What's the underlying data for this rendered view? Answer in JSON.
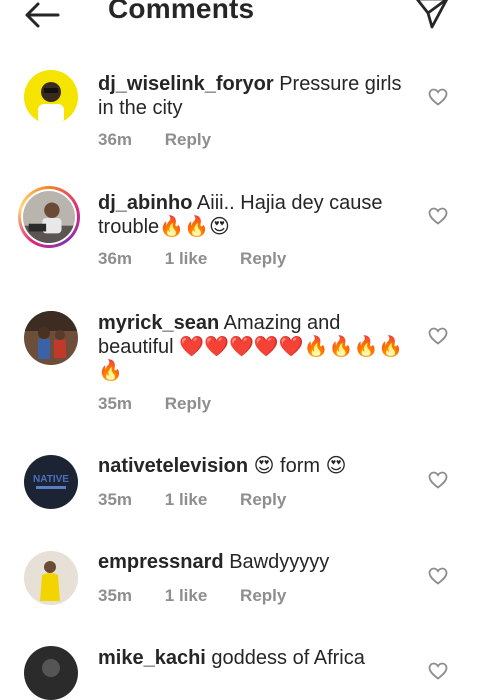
{
  "header": {
    "title": "Comments",
    "back_icon": "back-arrow-icon",
    "send_icon": "send-icon"
  },
  "comments": [
    {
      "username": "dj_wiselink_foryor",
      "text": "Pressure girls in the city",
      "time": "36m",
      "likes": "",
      "reply": "Reply"
    },
    {
      "username": "dj_abinho",
      "text": "Aiii.. Hajia dey cause trouble🔥🔥😍",
      "time": "36m",
      "likes": "1 like",
      "reply": "Reply"
    },
    {
      "username": "myrick_sean",
      "text": "Amazing and beautiful ❤️❤️❤️❤️❤️🔥🔥🔥🔥🔥",
      "time": "35m",
      "likes": "",
      "reply": "Reply"
    },
    {
      "username": "nativetelevision",
      "text": "😍 form 😍",
      "time": "35m",
      "likes": "1 like",
      "reply": "Reply"
    },
    {
      "username": "empressnard",
      "text": "Bawdyyyyy",
      "time": "35m",
      "likes": "1 like",
      "reply": "Reply"
    },
    {
      "username": "mike_kachi",
      "text": "goddess of Africa",
      "time": "",
      "likes": "",
      "reply": ""
    }
  ],
  "colors": {
    "text": "#262626",
    "meta": "#8e8e8e",
    "heart_outline": "#8e8e8e"
  }
}
